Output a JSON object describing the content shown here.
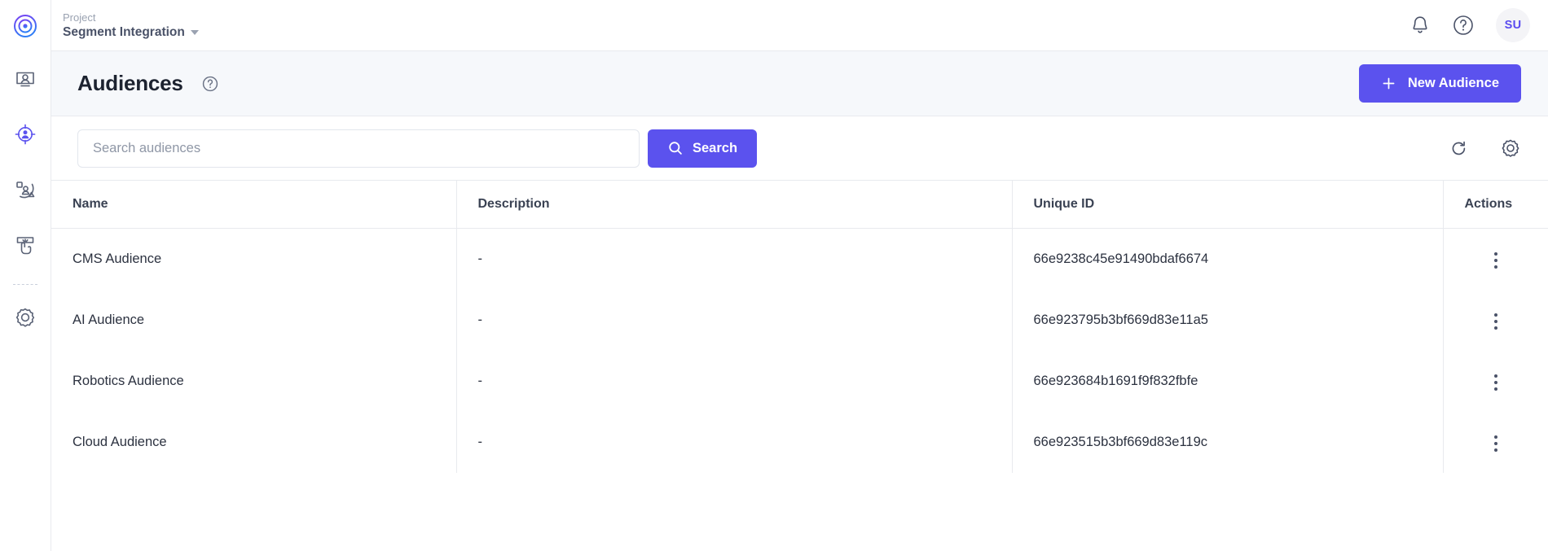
{
  "app": {
    "logo_icon": "target-logo-icon"
  },
  "sidebar": {
    "items": [
      {
        "icon": "audience-screen-icon",
        "name": "audiences"
      },
      {
        "icon": "targeting-crosshair-person-icon",
        "name": "targeting"
      },
      {
        "icon": "segments-pie-person-icon",
        "name": "segments"
      },
      {
        "icon": "experience-click-icon",
        "name": "experiences"
      },
      {
        "icon": "gear-icon",
        "name": "settings"
      }
    ]
  },
  "topbar": {
    "project_label": "Project",
    "project_name": "Segment Integration",
    "caret_icon": "chevron-down-icon",
    "notifications_icon": "bell-icon",
    "help_icon": "question-circle-icon",
    "avatar_initials": "SU"
  },
  "page_header": {
    "title": "Audiences",
    "help_icon": "question-circle-icon",
    "new_audience_label": "New Audience",
    "new_audience_icon": "plus-icon"
  },
  "toolbar": {
    "search_placeholder": "Search audiences",
    "search_value": "",
    "search_button_label": "Search",
    "search_icon": "magnifier-icon",
    "refresh_icon": "refresh-icon",
    "settings_icon": "gear-icon"
  },
  "table": {
    "columns": [
      "Name",
      "Description",
      "Unique ID",
      "Actions"
    ],
    "rows": [
      {
        "name": "CMS Audience",
        "description": "-",
        "unique_id": "66e9238c45e91490bdaf6674",
        "action_icon": "kebab-menu-icon"
      },
      {
        "name": "AI Audience",
        "description": "-",
        "unique_id": "66e923795b3bf669d83e11a5",
        "action_icon": "kebab-menu-icon"
      },
      {
        "name": "Robotics Audience",
        "description": "-",
        "unique_id": "66e923684b1691f9f832fbfe",
        "action_icon": "kebab-menu-icon"
      },
      {
        "name": "Cloud Audience",
        "description": "-",
        "unique_id": "66e923515b3bf669d83e119c",
        "action_icon": "kebab-menu-icon"
      }
    ]
  },
  "colors": {
    "accent": "#5b52ee",
    "logo_gradient_start": "#7b3ff2",
    "logo_gradient_end": "#2f7df6",
    "header_band": "#f6f8fb",
    "icon_gray": "#5a6276",
    "border": "#e8eaee"
  }
}
